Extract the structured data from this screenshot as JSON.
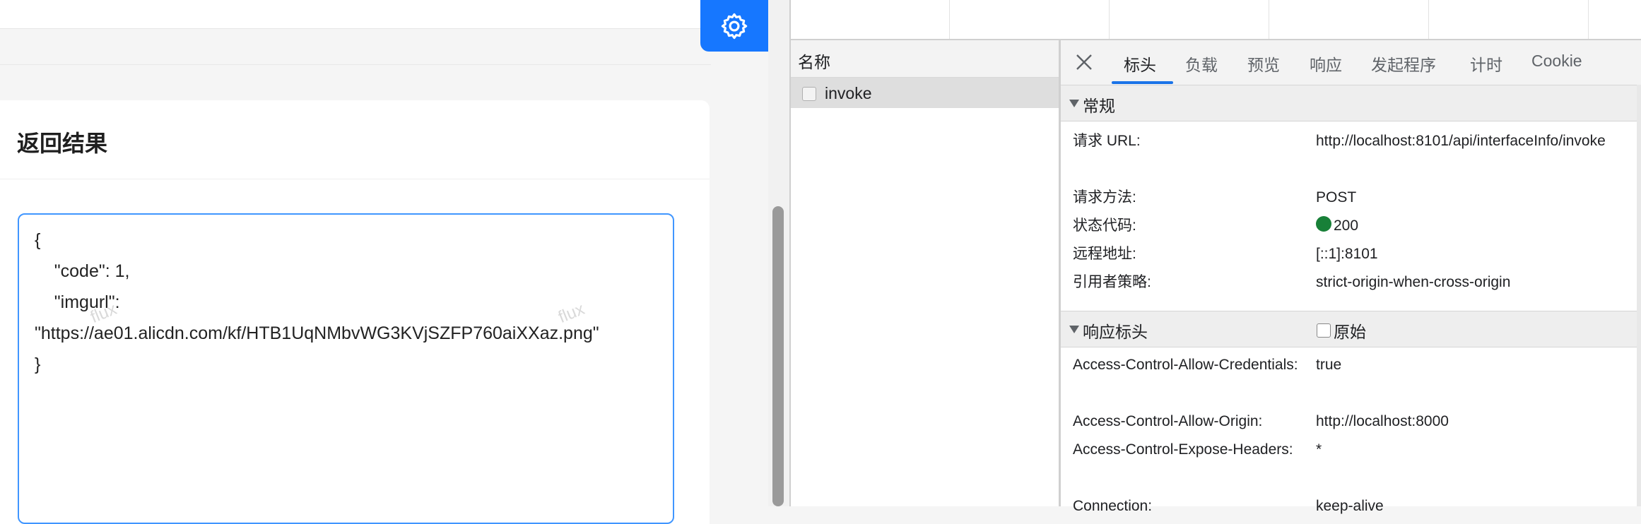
{
  "app": {
    "result_title": "返回结果",
    "result_text": "{\n    \"code\": 1,\n    \"imgurl\":\n\"https://ae01.alicdn.com/kf/HTB1UqNMbvWG3KVjSZFP760aiXXaz.png\"\n}",
    "watermark": "flux",
    "accent_color": "#1677ff",
    "settings_icon": "gear-icon"
  },
  "devtools": {
    "list_header": "名称",
    "request_name": "invoke",
    "tabs": [
      "标头",
      "负载",
      "预览",
      "响应",
      "发起程序",
      "计时",
      "Cookie"
    ],
    "active_tab": "标头",
    "general": {
      "title": "常规",
      "rows": [
        {
          "key": "请求 URL:",
          "value": "http://localhost:8101/api/interfaceInfo/invoke"
        },
        {
          "key": "请求方法:",
          "value": "POST"
        },
        {
          "key": "状态代码:",
          "value": "200"
        },
        {
          "key": "远程地址:",
          "value": "[::1]:8101"
        },
        {
          "key": "引用者策略:",
          "value": "strict-origin-when-cross-origin"
        }
      ]
    },
    "response_headers": {
      "title": "响应标头",
      "raw_label": "原始",
      "rows": [
        {
          "key": "Access-Control-Allow-Credentials:",
          "value": "true"
        },
        {
          "key": "Access-Control-Allow-Origin:",
          "value": "http://localhost:8000"
        },
        {
          "key": "Access-Control-Expose-Headers:",
          "value": "*"
        },
        {
          "key": "Connection:",
          "value": "keep-alive"
        }
      ]
    },
    "status_color": "#188038"
  }
}
